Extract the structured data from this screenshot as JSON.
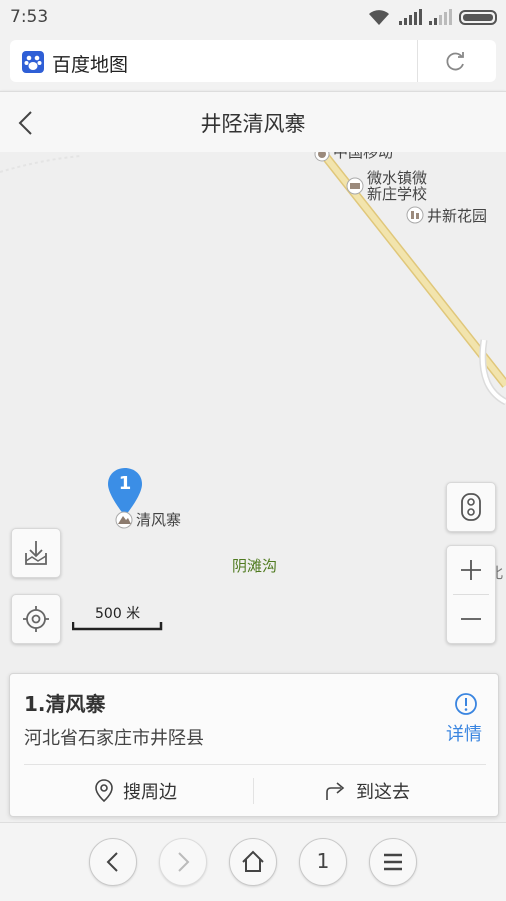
{
  "status_bar": {
    "time": "7:53"
  },
  "url_bar": {
    "title": "百度地图"
  },
  "header": {
    "title": "井陉清风寨"
  },
  "map": {
    "pois": {
      "top_partial": "中国移动",
      "school": "微水镇微\n新庄学校",
      "school_line1": "微水镇微",
      "school_line2": "新庄学校",
      "garden": "井新花园",
      "marker_poi": "清风寨",
      "valley": "阴滩沟",
      "edge_partial": "北"
    },
    "marker_number": "1",
    "scale_label": "500 米"
  },
  "result_card": {
    "name": "1.清风寨",
    "address": "河北省石家庄市井陉县",
    "detail_label": "详情",
    "search_nearby_label": "搜周边",
    "go_here_label": "到这去"
  },
  "bottom_bar": {
    "tab_count": "1"
  },
  "colors": {
    "accent": "#3a85e0",
    "marker": "#3b8ee6",
    "road": "#f0e2a8",
    "road_edge": "#e0c77a"
  }
}
